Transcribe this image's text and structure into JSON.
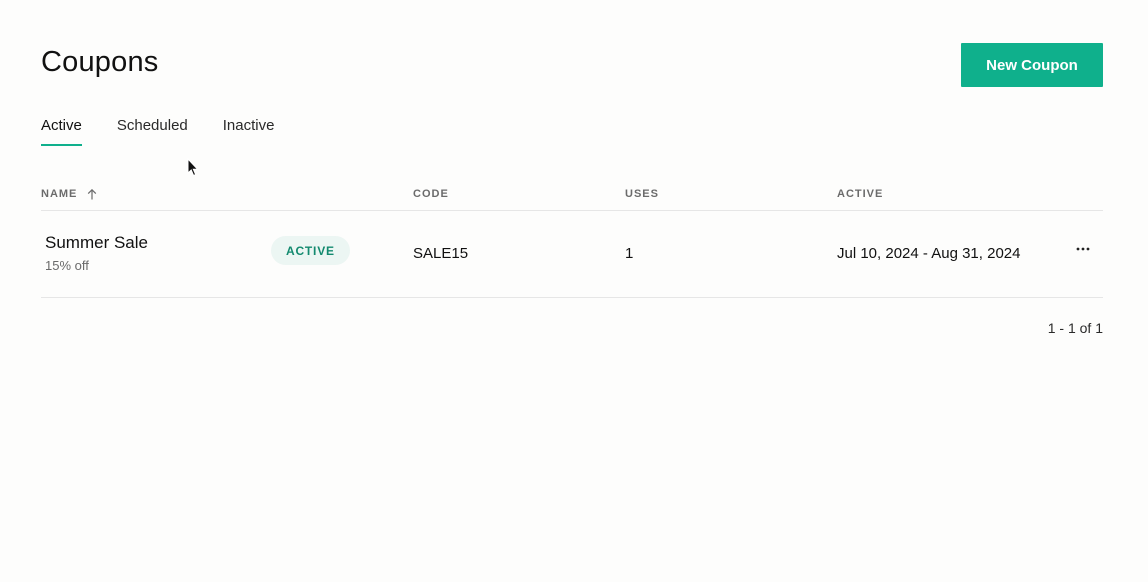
{
  "header": {
    "title": "Coupons",
    "new_button_label": "New Coupon"
  },
  "tabs": [
    {
      "label": "Active",
      "selected": true
    },
    {
      "label": "Scheduled",
      "selected": false
    },
    {
      "label": "Inactive",
      "selected": false
    }
  ],
  "table": {
    "columns": {
      "name": "NAME",
      "code": "CODE",
      "uses": "USES",
      "active": "ACTIVE"
    },
    "sort": {
      "column": "name",
      "direction": "ascending",
      "icon": "arrow-up-icon"
    },
    "rows": [
      {
        "name": "Summer Sale",
        "description": "15% off",
        "status": "ACTIVE",
        "code": "SALE15",
        "uses": "1",
        "dates": "Jul 10, 2024 - Aug 31, 2024",
        "menu_icon": "more-horizontal-icon"
      }
    ]
  },
  "pagination": {
    "text": "1 - 1 of 1"
  },
  "colors": {
    "accent": "#0fb08c",
    "badge_bg": "#ecf6f3",
    "badge_text": "#138a6f",
    "background": "#fdfdfc"
  }
}
